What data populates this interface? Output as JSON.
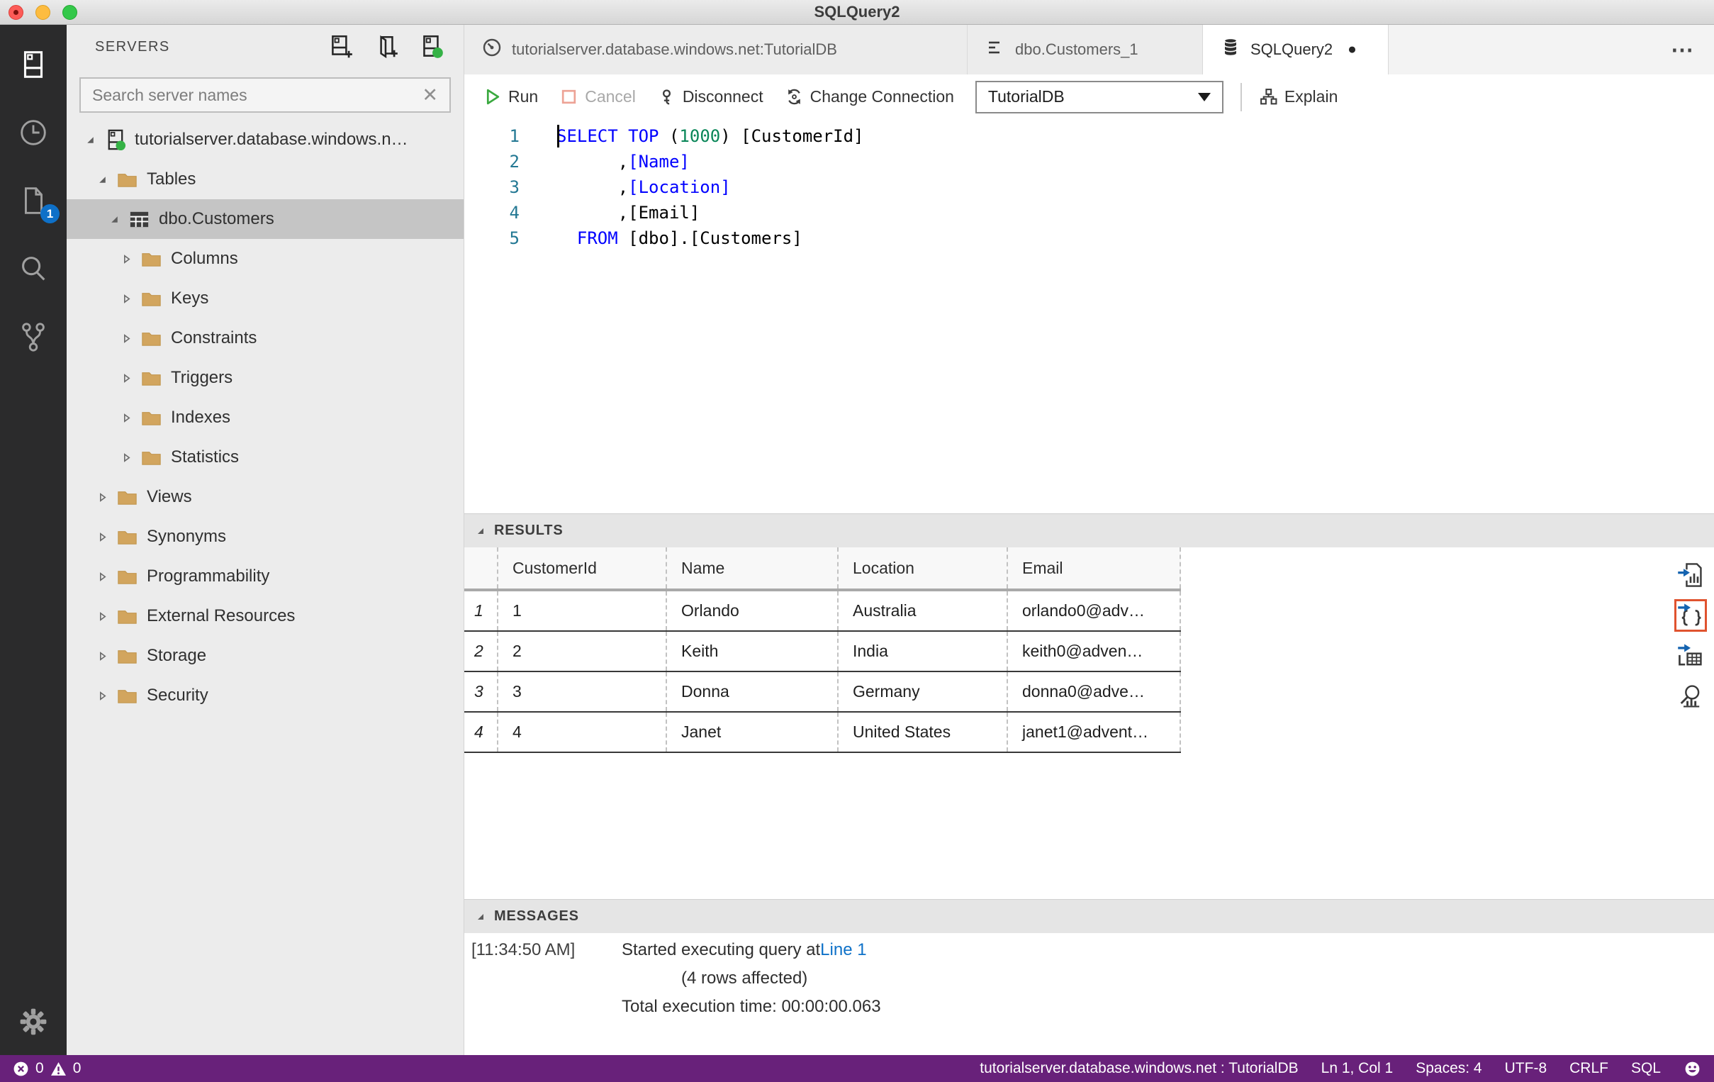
{
  "window": {
    "title": "SQLQuery2"
  },
  "activity_bar": {
    "badge": "1",
    "icons": [
      "connections",
      "history",
      "open-file",
      "search",
      "source-control"
    ],
    "bottom_icon": "settings-gear"
  },
  "sidebar": {
    "title": "SERVERS",
    "actions": [
      "new-connection",
      "new-server-group",
      "active-connections"
    ],
    "search": {
      "placeholder": "Search server names",
      "clear_icon": "x"
    },
    "tree": [
      {
        "label": "tutorialserver.database.windows.n…",
        "level": 0,
        "icon": "server",
        "state": "expanded",
        "selected": false
      },
      {
        "label": "Tables",
        "level": 1,
        "icon": "folder",
        "state": "expanded",
        "selected": false
      },
      {
        "label": "dbo.Customers",
        "level": 2,
        "icon": "table",
        "state": "expanded",
        "selected": true
      },
      {
        "label": "Columns",
        "level": 3,
        "icon": "folder",
        "state": "collapsed",
        "selected": false
      },
      {
        "label": "Keys",
        "level": 3,
        "icon": "folder",
        "state": "collapsed",
        "selected": false
      },
      {
        "label": "Constraints",
        "level": 3,
        "icon": "folder",
        "state": "collapsed",
        "selected": false
      },
      {
        "label": "Triggers",
        "level": 3,
        "icon": "folder",
        "state": "collapsed",
        "selected": false
      },
      {
        "label": "Indexes",
        "level": 3,
        "icon": "folder",
        "state": "collapsed",
        "selected": false
      },
      {
        "label": "Statistics",
        "level": 3,
        "icon": "folder",
        "state": "collapsed",
        "selected": false
      },
      {
        "label": "Views",
        "level": 1,
        "icon": "folder",
        "state": "collapsed",
        "selected": false
      },
      {
        "label": "Synonyms",
        "level": 1,
        "icon": "folder",
        "state": "collapsed",
        "selected": false
      },
      {
        "label": "Programmability",
        "level": 1,
        "icon": "folder",
        "state": "collapsed",
        "selected": false
      },
      {
        "label": "External Resources",
        "level": 1,
        "icon": "folder",
        "state": "collapsed",
        "selected": false
      },
      {
        "label": "Storage",
        "level": 1,
        "icon": "folder",
        "state": "collapsed",
        "selected": false
      },
      {
        "label": "Security",
        "level": 1,
        "icon": "folder",
        "state": "collapsed",
        "selected": false
      }
    ]
  },
  "tabs": [
    {
      "label": "tutorialserver.database.windows.net:TutorialDB",
      "icon": "dashboard",
      "active": false,
      "dirty": false
    },
    {
      "label": "dbo.Customers_1",
      "icon": "edit-data",
      "active": false,
      "dirty": false
    },
    {
      "label": "SQLQuery2",
      "icon": "database",
      "active": true,
      "dirty": true
    }
  ],
  "tabs_more_icon": "ellipsis",
  "toolbar": {
    "run": "Run",
    "cancel": "Cancel",
    "disconnect": "Disconnect",
    "change_connection": "Change Connection",
    "database_dropdown": "TutorialDB",
    "explain": "Explain"
  },
  "editor": {
    "lines": [
      {
        "num": "1",
        "tokens": [
          {
            "c": "kw",
            "t": "SELECT"
          },
          {
            "c": "d",
            "t": " "
          },
          {
            "c": "kw",
            "t": "TOP"
          },
          {
            "c": "d",
            "t": " ("
          },
          {
            "c": "num",
            "t": "1000"
          },
          {
            "c": "d",
            "t": ") [CustomerId]"
          }
        ]
      },
      {
        "num": "2",
        "tokens": [
          {
            "c": "d",
            "t": "      ,"
          },
          {
            "c": "kw",
            "t": "[Name]"
          }
        ]
      },
      {
        "num": "3",
        "tokens": [
          {
            "c": "d",
            "t": "      ,"
          },
          {
            "c": "kw",
            "t": "[Location]"
          }
        ]
      },
      {
        "num": "4",
        "tokens": [
          {
            "c": "d",
            "t": "      ,[Email]"
          }
        ]
      },
      {
        "num": "5",
        "tokens": [
          {
            "c": "d",
            "t": "  "
          },
          {
            "c": "kw",
            "t": "FROM"
          },
          {
            "c": "d",
            "t": " [dbo].[Customers]"
          }
        ]
      }
    ]
  },
  "results": {
    "title": "RESULTS",
    "columns": [
      "CustomerId",
      "Name",
      "Location",
      "Email"
    ],
    "rows": [
      {
        "n": "1",
        "cells": [
          "1",
          "Orlando",
          "Australia",
          "orlando0@adv…"
        ]
      },
      {
        "n": "2",
        "cells": [
          "2",
          "Keith",
          "India",
          "keith0@adven…"
        ]
      },
      {
        "n": "3",
        "cells": [
          "3",
          "Donna",
          "Germany",
          "donna0@adve…"
        ]
      },
      {
        "n": "4",
        "cells": [
          "4",
          "Janet",
          "United States",
          "janet1@advent…"
        ]
      }
    ],
    "export_actions": [
      "save-as-csv",
      "save-as-json",
      "save-as-excel",
      "view-as-chart"
    ],
    "focused_action": "save-as-json"
  },
  "messages": {
    "title": "MESSAGES",
    "entries": [
      {
        "time": "[11:34:50 AM]",
        "text": "Started executing query at ",
        "link": "Line 1",
        "indent": false
      },
      {
        "time": "",
        "text": "(4 rows affected)",
        "link": "",
        "indent": true
      },
      {
        "time": "",
        "text": "Total execution time: 00:00:00.063",
        "link": "",
        "indent": false
      }
    ]
  },
  "status_bar": {
    "errors": "0",
    "warnings": "0",
    "items": [
      "tutorialserver.database.windows.net : TutorialDB",
      "Ln 1, Col 1",
      "Spaces: 4",
      "UTF-8",
      "CRLF",
      "SQL"
    ],
    "smiley_icon": "smiley"
  },
  "colors": {
    "status_purple": "#68217a",
    "keyword_blue": "#0000ff",
    "number_green": "#098658",
    "line_number_teal": "#237893",
    "badge_blue": "#0e70c8",
    "folder_tan": "#d2a55e",
    "connection_green": "#35b246",
    "focus_orange": "#e0532f"
  }
}
